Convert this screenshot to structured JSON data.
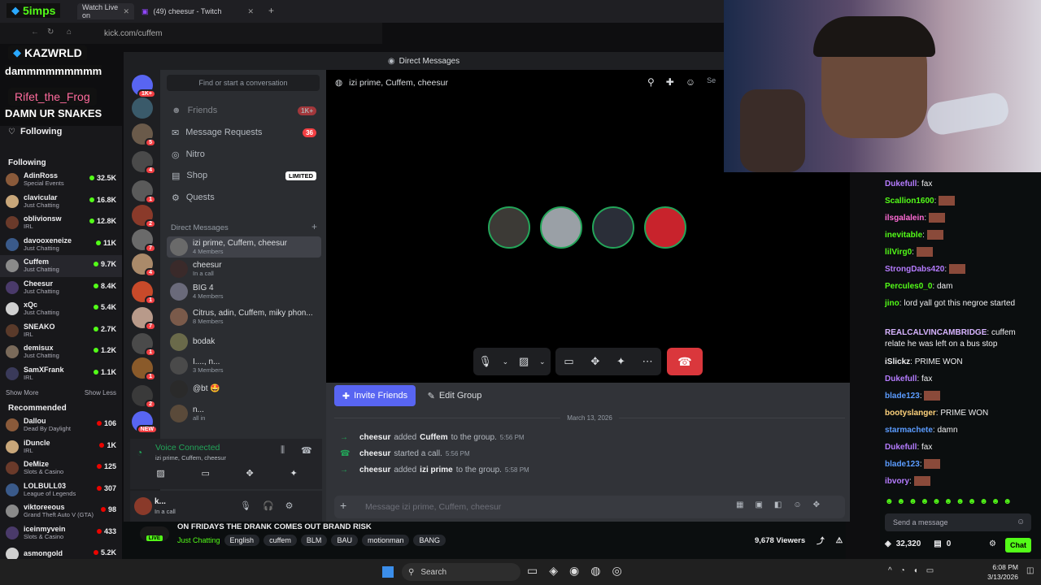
{
  "browser": {
    "tabs": [
      {
        "label": "Watch Live on"
      },
      {
        "label": "(49) cheesur - Twitch"
      }
    ],
    "url": "kick.com/cuffem"
  },
  "overlay": {
    "badge1": "5imps",
    "badge2": "KAZWRLD",
    "line1": "dammmmmmmmm",
    "badge3": "Rifet_the_Frog",
    "line2": "DAMN UR SNAKES"
  },
  "sidebar": {
    "following_title": "Following",
    "following_header": "Following",
    "following": [
      {
        "name": "AdinRoss",
        "category": "Special Events",
        "viewers": "32.5K"
      },
      {
        "name": "clavicular",
        "category": "Just Chatting",
        "viewers": "16.8K"
      },
      {
        "name": "oblivionsw",
        "category": "IRL",
        "viewers": "12.8K"
      },
      {
        "name": "davooxeneize",
        "category": "Just Chatting",
        "viewers": "11K"
      },
      {
        "name": "Cuffem",
        "category": "Just Chatting",
        "viewers": "9.7K"
      },
      {
        "name": "Cheesur",
        "category": "Just Chatting",
        "viewers": "8.4K"
      },
      {
        "name": "xQc",
        "category": "Just Chatting",
        "viewers": "5.4K"
      },
      {
        "name": "SNEAKO",
        "category": "IRL",
        "viewers": "2.7K"
      },
      {
        "name": "demisux",
        "category": "Just Chatting",
        "viewers": "1.2K"
      },
      {
        "name": "SamXFrank",
        "category": "IRL",
        "viewers": "1.1K"
      }
    ],
    "show_more": "Show More",
    "show_less": "Show Less",
    "recommended_header": "Recommended",
    "recommended": [
      {
        "name": "Dallou",
        "category": "Dead By Daylight",
        "viewers": "106"
      },
      {
        "name": "iDuncle",
        "category": "IRL",
        "viewers": "1K"
      },
      {
        "name": "DeMize",
        "category": "Slots & Casino",
        "viewers": "125"
      },
      {
        "name": "LOLBULL03",
        "category": "League of Legends",
        "viewers": "307"
      },
      {
        "name": "viktoreeous",
        "category": "Grand Theft Auto V (GTA)",
        "viewers": "98"
      },
      {
        "name": "iceinmyvein",
        "category": "Slots & Casino",
        "viewers": "433"
      },
      {
        "name": "asmongold",
        "category": "",
        "viewers": "5.2K"
      }
    ]
  },
  "discord": {
    "window_title": "Direct Messages",
    "guild_badges": [
      "1K+",
      "",
      "5",
      "4",
      "1",
      "2",
      "7",
      "4",
      "1",
      "7",
      "1",
      "1",
      "2",
      "NEW"
    ],
    "search_placeholder": "Find or start a conversation",
    "nav": {
      "friends": "Friends",
      "friends_count": "1K+",
      "requests": "Message Requests",
      "requests_count": "36",
      "nitro": "Nitro",
      "shop": "Shop",
      "shop_badge": "LIMITED",
      "quests": "Quests"
    },
    "dm_header": "Direct Messages",
    "dms": [
      {
        "name": "izi prime, Cuffem, cheesur",
        "sub": "4 Members"
      },
      {
        "name": "cheesur",
        "sub": "In a call"
      },
      {
        "name": "BIG 4",
        "sub": "4 Members"
      },
      {
        "name": "Citrus, adin, Cuffem, miky phon...",
        "sub": "8 Members"
      },
      {
        "name": "bodak",
        "sub": ""
      },
      {
        "name": "I...., n...",
        "sub": "3 Members"
      },
      {
        "name": "@bt 🤩",
        "sub": ""
      },
      {
        "name": "n...",
        "sub": "all in"
      }
    ],
    "voice_status": "Voice Connected",
    "voice_channel": "izi prime, Cuffem, cheesur",
    "user_name": "k...",
    "user_status": "In a call",
    "channel_title": "izi prime, Cuffem, cheesur",
    "search_label": "Se",
    "invite_label": "Invite Friends",
    "edit_label": "Edit Group",
    "date_divider": "March 13, 2026",
    "system_messages": [
      {
        "actor": "cheesur",
        "verb": "added",
        "target": "Cuffem",
        "rest": "to the group.",
        "time": "5:56 PM"
      },
      {
        "actor": "cheesur",
        "verb": "started a call.",
        "target": "",
        "rest": "",
        "time": "5:56 PM"
      },
      {
        "actor": "cheesur",
        "verb": "added",
        "target": "izi prime",
        "rest": "to the group.",
        "time": "5:58 PM"
      }
    ],
    "message_placeholder": "Message izi prime, Cuffem, cheesur"
  },
  "stream": {
    "live": "LIVE",
    "title": "ON FRIDAYS THE DRANK COMES OUT BRAND RISK",
    "category": "Just Chatting",
    "tags": [
      "English",
      "cuffem",
      "BLM",
      "BAU",
      "motionman",
      "BANG"
    ],
    "viewers": "9,678 Viewers"
  },
  "chat": {
    "messages": [
      {
        "user": "Dukefull",
        "text": "fax",
        "color": "#b57cff"
      },
      {
        "user": "Scallion1600",
        "text": "",
        "color": "#53fc18"
      },
      {
        "user": "ilsgalalein",
        "text": "",
        "color": "#ff6bd5"
      },
      {
        "user": "inevitable",
        "text": "",
        "color": "#53fc18"
      },
      {
        "user": "lilVirg0",
        "text": "",
        "color": "#53fc18"
      },
      {
        "user": "StrongDabs420",
        "text": "",
        "color": "#b57cff"
      },
      {
        "user": "Percules0_0",
        "text": "dam",
        "color": "#53fc18"
      },
      {
        "user": "jino",
        "text": "lord yall got this negroe started",
        "color": "#53fc18"
      },
      {
        "user": "REALCALVINCAMBRIDGE",
        "text": "cuffem relate he was left on a bus stop",
        "color": "#d7b4ff"
      },
      {
        "user": "iSlickz",
        "text": "PRIME WON",
        "color": "#efeff1"
      },
      {
        "user": "Dukefull",
        "text": "fax",
        "color": "#b57cff"
      },
      {
        "user": "blade123",
        "text": "",
        "color": "#5b9cff"
      },
      {
        "user": "bootyslanger",
        "text": "PRIME WON",
        "color": "#ffd37c"
      },
      {
        "user": "starmachete",
        "text": "damn",
        "color": "#5b9cff"
      },
      {
        "user": "Dukefull",
        "text": "fax",
        "color": "#b57cff"
      },
      {
        "user": "blade123",
        "text": "",
        "color": "#5b9cff"
      },
      {
        "user": "ibvory",
        "text": "",
        "color": "#b57cff"
      }
    ],
    "input_placeholder": "Send a message",
    "points": "32,320",
    "zero": "0",
    "chat_button": "Chat"
  },
  "taskbar": {
    "search": "Search",
    "time": "6:08 PM",
    "date": "3/13/2026"
  },
  "colors": {
    "kick_green": "#53fc18",
    "discord_blurple": "#5865f2",
    "end_call_red": "#da373c"
  }
}
